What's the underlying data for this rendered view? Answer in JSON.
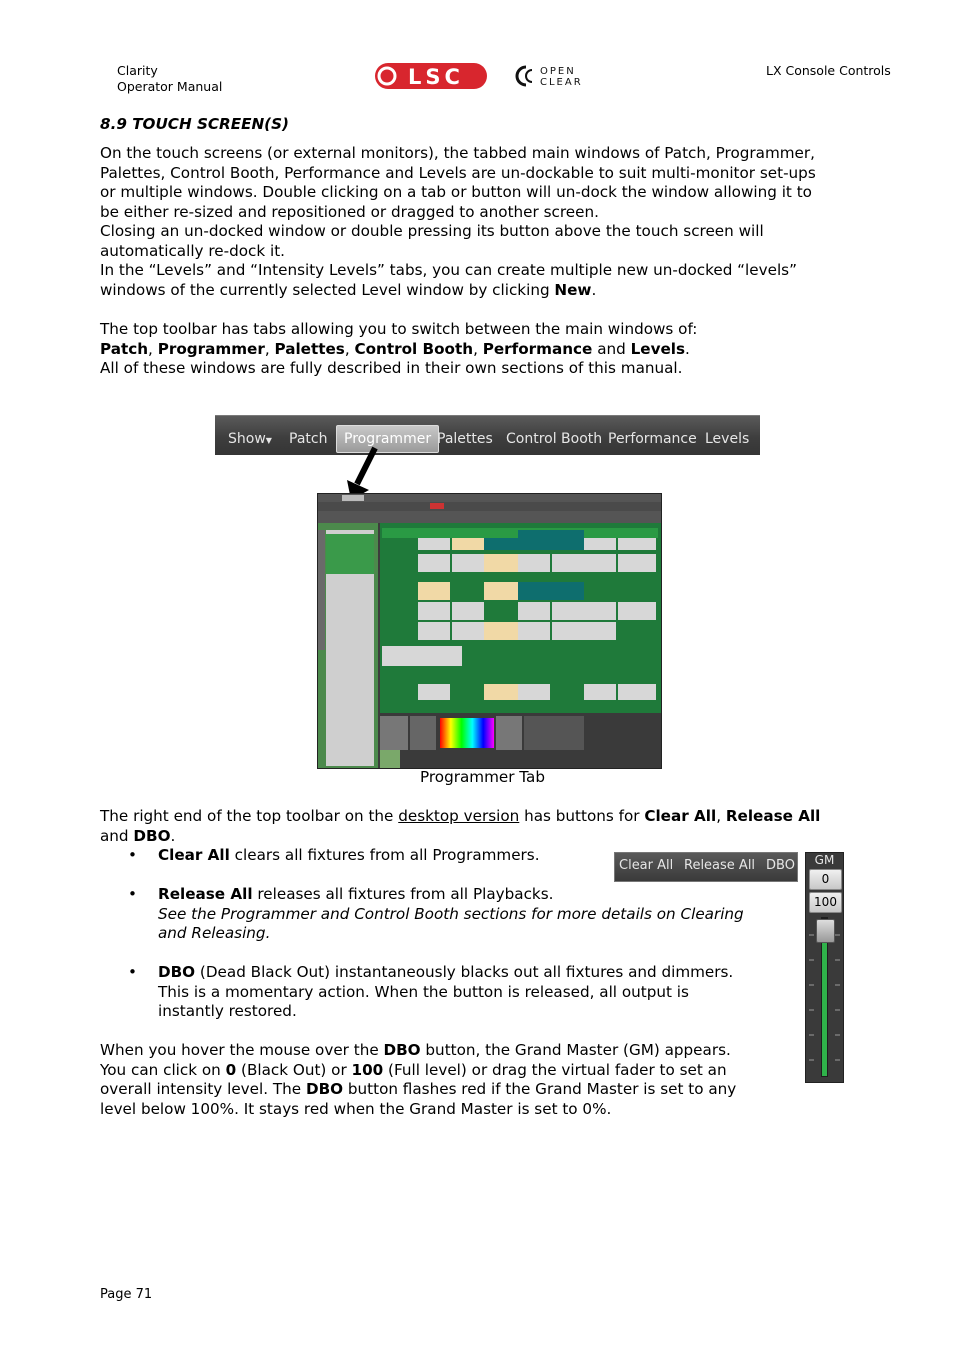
{
  "header": {
    "left_line1": "Clarity",
    "left_line2": "Operator Manual",
    "right": "LX Console Controls",
    "logo_lsc": "LSC",
    "logo_open_top": "OPEN",
    "logo_open_bottom": "CLEAR"
  },
  "section": {
    "title": "8.9   TOUCH SCREEN(S)"
  },
  "para1": {
    "line1": "On the touch screens (or external monitors), the tabbed main windows of Patch, Programmer,",
    "line2": "Palettes, Control Booth, Performance and Levels are un-dockable to suit multi-monitor set-ups",
    "line3": "or multiple windows. Double clicking on a tab or button will un-dock the window allowing it to",
    "line4": "be either re-sized and repositioned or dragged to another screen.",
    "line5": "Closing an un-docked window or double pressing its button above the touch screen will",
    "line6": "automatically re-dock it.",
    "line7": "In the “Levels” and “Intensity Levels” tabs, you can create multiple new un-docked “levels”",
    "line8_pre": "windows of the currently selected Level window by clicking ",
    "line8_bold": "New",
    "line8_post": "."
  },
  "para2": {
    "line1": "The top toolbar has tabs allowing you to switch between the main windows of:",
    "w_patch": "Patch",
    "w_programmer": "Programmer",
    "w_palettes": "Palettes",
    "w_control_booth": "Control Booth",
    "w_performance": "Performance",
    "w_and": "and",
    "w_levels": "Levels",
    "sep": ",",
    "dot": ".",
    "line3": "All of these windows are fully described in their own sections of this manual."
  },
  "toolbar": {
    "tabs": [
      "Show",
      "Patch",
      "Programmer",
      "Palettes",
      "Control Booth",
      "Performance",
      "Levels"
    ]
  },
  "figure": {
    "caption": "Programmer Tab"
  },
  "para3": {
    "pre": "The right end of the top toolbar on the ",
    "link": "desktop version",
    "mid": " has buttons for ",
    "b1": "Clear All",
    "comma": ", ",
    "b2": "Release All",
    "line2_pre": "and ",
    "b3": "DBO",
    "dot": "."
  },
  "bullets": {
    "b1_bold": "Clear All",
    "b1_text": " clears all fixtures from all Programmers.",
    "b2_bold": "Release All",
    "b2_text": " releases all fixtures from all Playbacks.",
    "b2_italic1": "See the Programmer and Control Booth sections for more details on Clearing",
    "b2_italic2": "and Releasing.",
    "b3_bold": "DBO",
    "b3_text": " (Dead Black Out) instantaneously blacks out all fixtures and dimmers.",
    "b3_line2": "This is a momentary action. When the button is released, all output is",
    "b3_line3": "instantly restored."
  },
  "right_toolbar": {
    "buttons": [
      "Clear All",
      "Release All",
      "DBO"
    ]
  },
  "grand_master": {
    "label": "GM",
    "btn0": "0",
    "btn100": "100",
    "level": 1.0
  },
  "para4": {
    "l1_pre": "When you hover the mouse over the ",
    "l1_b": "DBO",
    "l1_post": " button, the Grand Master (GM) appears.",
    "l2_pre": "You can click on ",
    "l2_b1": "0",
    "l2_mid1": " (Black Out) or ",
    "l2_b2": "100",
    "l2_mid2": " (Full level) or drag the virtual fader to set an",
    "l3_pre": "overall intensity level. The ",
    "l3_b": "DBO",
    "l3_post": " button flashes red if the Grand Master is set to any",
    "l4": "level below 100%. It stays red when the Grand Master is set to 0%."
  },
  "footer": {
    "page": "Page 71"
  },
  "colors": {
    "lsc_red": "#d8262e",
    "toolbar_dark": "#3e3e3e",
    "fader_green": "#2fb24a"
  }
}
